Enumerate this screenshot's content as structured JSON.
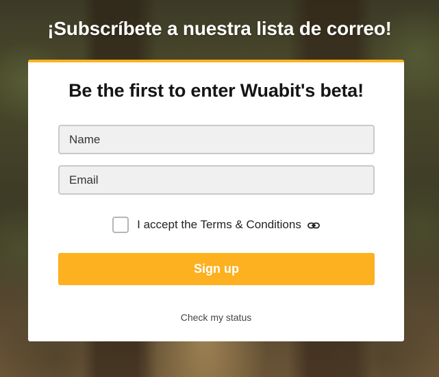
{
  "page": {
    "heading": "¡Subscríbete a nuestra lista de correo!"
  },
  "form": {
    "title": "Be the first to enter Wuabit's beta!",
    "name_placeholder": "Name",
    "email_placeholder": "Email",
    "terms_label": "I accept the Terms & Conditions",
    "terms_icon": "link-icon",
    "terms_checked": false,
    "signup_label": "Sign up",
    "status_link": "Check my status"
  },
  "colors": {
    "accent": "#fdb120",
    "card_background": "#ffffff",
    "field_background": "#f0f0f0"
  }
}
